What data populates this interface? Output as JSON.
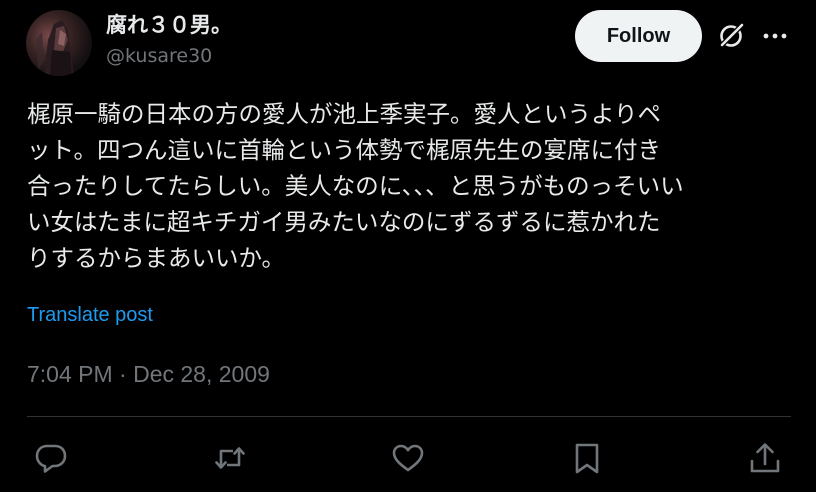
{
  "author": {
    "display_name": "腐れ３０男。",
    "handle": "@kusare30"
  },
  "header": {
    "follow_label": "Follow",
    "icons": [
      "grok-icon",
      "more-icon"
    ]
  },
  "post": {
    "text_lines": [
      "梶原一騎の日本の方の愛人が池上季実子。愛人というよりペ",
      "ット。四つん這いに首輪という体勢で梶原先生の宴席に付き",
      "合ったりしてたらしい。美人なのに、、、と思うがものっそいい",
      "い女はたまに超キチガイ男みたいなのにずるずるに惹かれた",
      "りするからまあいいか。"
    ],
    "translate_label": "Translate post",
    "timestamp": "7:04 PM · Dec 28, 2009"
  },
  "actions": [
    "reply-icon",
    "repost-icon",
    "like-icon",
    "bookmark-icon",
    "share-icon"
  ],
  "colors": {
    "background": "#000000",
    "text": "#e7e9ea",
    "secondary": "#71767b",
    "link": "#1d9bf0",
    "follow_bg": "#eff3f4",
    "divider": "#2f3336"
  }
}
